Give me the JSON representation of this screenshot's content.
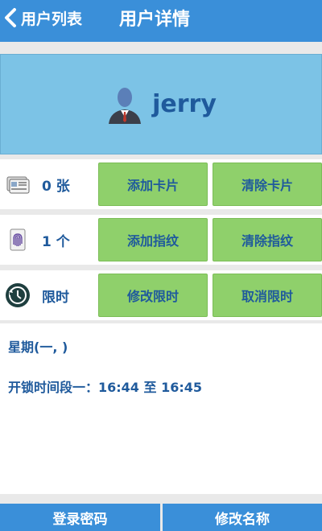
{
  "header": {
    "back_label": "用户列表",
    "title": "用户详情"
  },
  "profile": {
    "username": "jerry",
    "avatar_icon": "person-avatar-icon"
  },
  "card_row": {
    "icon": "card-icon",
    "label": "0 张",
    "add_button": "添加卡片",
    "clear_button": "清除卡片"
  },
  "fingerprint_row": {
    "icon": "fingerprint-icon",
    "label": "1 个",
    "add_button": "添加指纹",
    "clear_button": "清除指纹"
  },
  "time_limit_row": {
    "icon": "clock-history-icon",
    "label": "限时",
    "modify_button": "修改限时",
    "cancel_button": "取消限时"
  },
  "schedule": {
    "days": "星期(一, )",
    "unlock_period": "开锁时间段一：16:44 至 16:45"
  },
  "footer": {
    "login_password_button": "登录密码",
    "rename_button": "修改名称"
  },
  "colors": {
    "header_blue": "#3a8fd9",
    "profile_blue": "#7cc3e6",
    "button_green": "#8fd06b",
    "text_blue": "#1f5a9c"
  }
}
